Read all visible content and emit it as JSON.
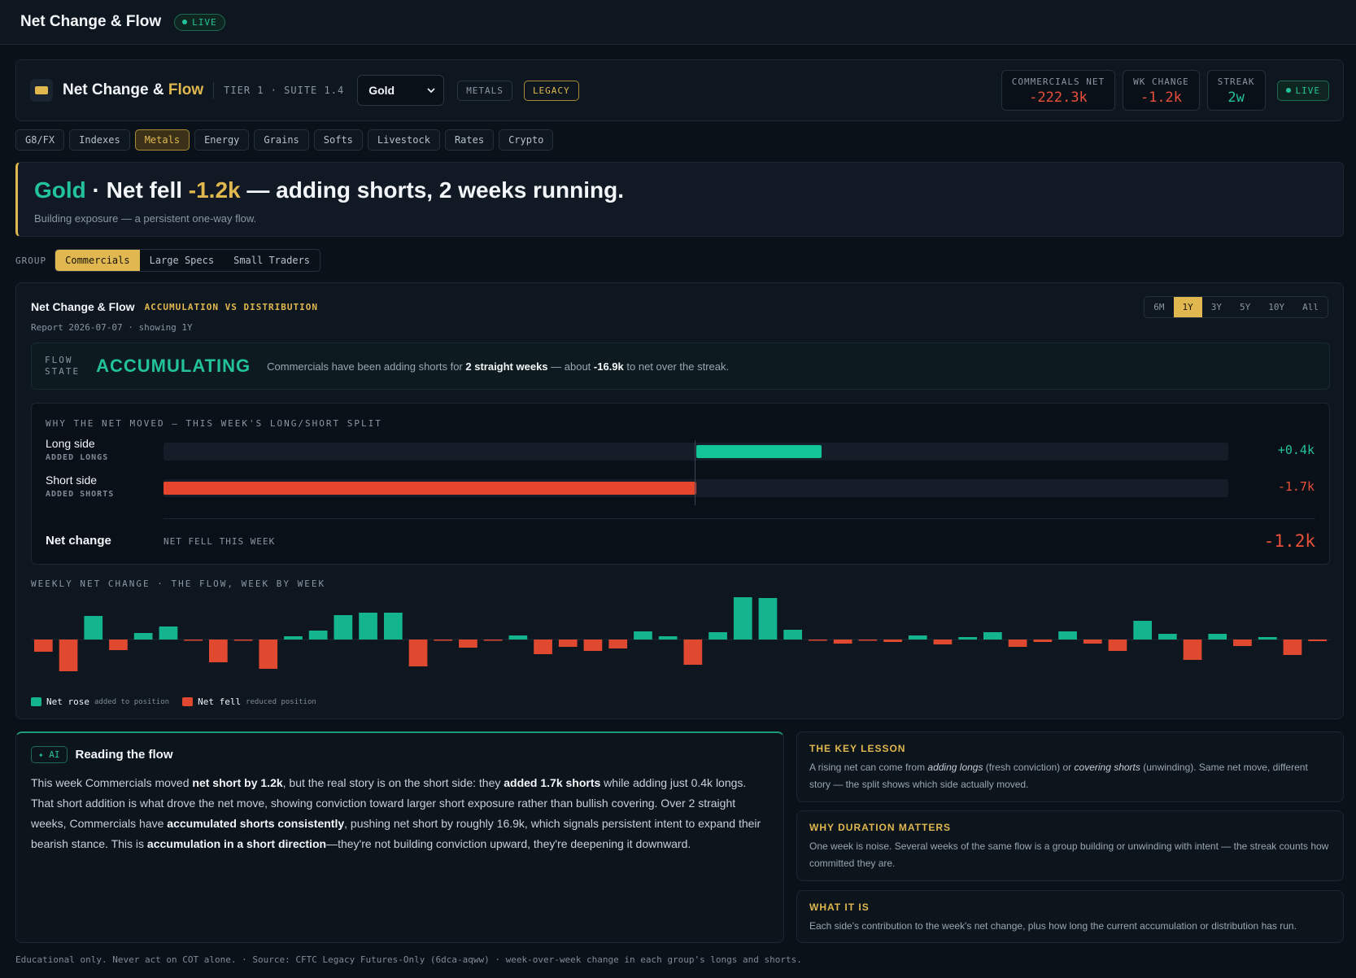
{
  "topbar": {
    "title": "Net Change & Flow",
    "live": "LIVE"
  },
  "header": {
    "title_main": "Net Change & ",
    "title_accent": "Flow",
    "tier": "TIER 1 · SUITE 1.4",
    "selected_market": "Gold",
    "tag_sector": "METALS",
    "tag_report": "LEGACY",
    "stats": [
      {
        "label": "COMMERCIALS NET",
        "value": "-222.3k",
        "tone": "red"
      },
      {
        "label": "WK CHANGE",
        "value": "-1.2k",
        "tone": "red"
      },
      {
        "label": "STREAK",
        "value": "2w",
        "tone": "green"
      }
    ],
    "live": "LIVE"
  },
  "categories": {
    "items": [
      "G8/FX",
      "Indexes",
      "Metals",
      "Energy",
      "Grains",
      "Softs",
      "Livestock",
      "Rates",
      "Crypto"
    ],
    "active": "Metals"
  },
  "headline": {
    "market": "Gold",
    "text1": " · Net fell ",
    "change": "-1.2k",
    "text2": " — adding shorts, 2 weeks running.",
    "sub": "Building exposure — a persistent one-way flow."
  },
  "group": {
    "label": "GROUP",
    "items": [
      "Commercials",
      "Large Specs",
      "Small Traders"
    ],
    "active": "Commercials"
  },
  "panel": {
    "title": "Net Change & Flow",
    "subtitle": "ACCUMULATION VS DISTRIBUTION",
    "report": "Report 2026-07-07 · showing 1Y",
    "ranges": [
      "6M",
      "1Y",
      "3Y",
      "5Y",
      "10Y",
      "All"
    ],
    "active_range": "1Y",
    "flow": {
      "label_line1": "FLOW",
      "label_line2": "STATE",
      "state": "ACCUMULATING",
      "desc_1": "Commercials have been adding shorts for ",
      "desc_weeks": "2 straight weeks",
      "desc_2": " — about ",
      "desc_amount": "-16.9k",
      "desc_3": " to net over the streak."
    },
    "split": {
      "heading": "WHY THE NET MOVED — THIS WEEK'S LONG/SHORT SPLIT",
      "scale_max": 1.7,
      "long": {
        "name": "Long side",
        "note": "ADDED LONGS",
        "value": 0.4,
        "label": "+0.4k"
      },
      "short": {
        "name": "Short side",
        "note": "ADDED SHORTS",
        "value": 1.7,
        "label": "-1.7k"
      },
      "net": {
        "name": "Net change",
        "note": "NET FELL THIS WEEK",
        "label": "-1.2k"
      }
    },
    "weekly": {
      "heading": "WEEKLY NET CHANGE · THE FLOW, WEEK BY WEEK",
      "values": [
        -1.5,
        -3.9,
        2.9,
        -1.3,
        0.8,
        1.6,
        -0.1,
        -2.8,
        -0.1,
        -3.6,
        0.4,
        1.1,
        3.0,
        3.3,
        3.3,
        -3.3,
        -0.1,
        -1.0,
        -0.1,
        0.5,
        -1.8,
        -0.9,
        -1.4,
        -1.1,
        1.0,
        0.4,
        -3.1,
        0.9,
        5.2,
        5.1,
        1.2,
        -0.1,
        -0.5,
        -0.1,
        -0.3,
        0.5,
        -0.6,
        0.3,
        0.9,
        -0.9,
        -0.3,
        1.0,
        -0.5,
        -1.4,
        2.3,
        0.7,
        -2.5,
        0.7,
        -0.8,
        0.3,
        -1.9,
        -0.2
      ],
      "legend": [
        {
          "name": "Net rose",
          "sub": "added to position",
          "color": "#13b48e"
        },
        {
          "name": "Net fell",
          "sub": "reduced position",
          "color": "#e0482f"
        }
      ]
    }
  },
  "ai": {
    "tag": "✦ AI",
    "title": "Reading the flow",
    "p1": "This week Commercials moved ",
    "b1": "net short by 1.2k",
    "p2": ", but the real story is on the short side: they ",
    "b2": "added 1.7k shorts",
    "p3": " while adding just 0.4k longs. That short addition is what drove the net move, showing conviction toward larger short exposure rather than bullish covering. Over 2 straight weeks, Commercials have ",
    "b3": "accumulated shorts consistently",
    "p4": ", pushing net short by roughly 16.9k, which signals persistent intent to expand their bearish stance. This is ",
    "b4": "accumulation in a short direction",
    "p5": "—they're not building conviction upward, they're deepening it downward."
  },
  "notes": [
    {
      "title": "THE KEY LESSON",
      "t1": "A rising net can come from ",
      "i1": "adding longs",
      "t2": " (fresh conviction) or ",
      "i2": "covering shorts",
      "t3": " (unwinding). Same net move, different story — the split shows which side actually moved."
    },
    {
      "title": "WHY DURATION MATTERS",
      "t1": "One week is noise. Several weeks of the same flow is a group building or unwinding with intent — the streak counts how committed they are."
    },
    {
      "title": "WHAT IT IS",
      "t1": "Each side's contribution to the week's net change, plus how long the current accumulation or distribution has run."
    }
  ],
  "footer": "Educational only. Never act on COT alone. · Source: CFTC Legacy Futures-Only (6dca-aqww) · week-over-week change in each group's longs and shorts.",
  "colors": {
    "gold": "#e0b84f",
    "green": "#22c39a",
    "red": "#e8503a"
  }
}
